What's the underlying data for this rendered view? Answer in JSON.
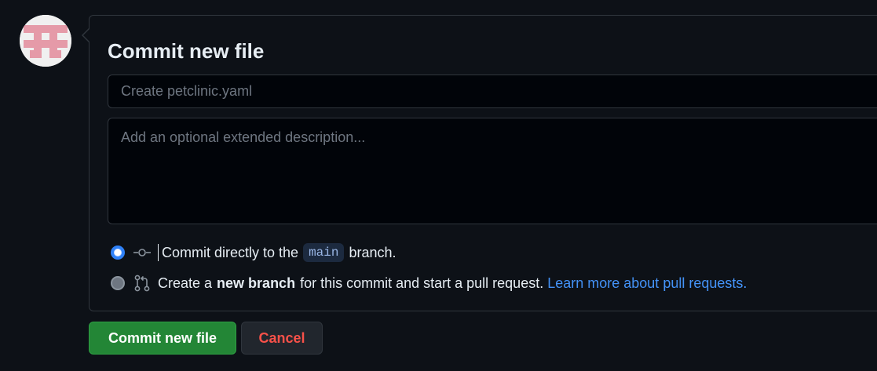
{
  "avatar": {
    "icon": "identicon-avatar",
    "color": "#e59aa8"
  },
  "commit": {
    "title": "Commit new file",
    "summary_placeholder": "Create petclinic.yaml",
    "summary_value": "",
    "description_placeholder": "Add an optional extended description...",
    "description_value": ""
  },
  "options": {
    "direct": {
      "selected": true,
      "icon": "git-commit-icon",
      "text_before": "Commit directly to the",
      "branch": "main",
      "text_after": "branch."
    },
    "new_branch": {
      "selected": false,
      "icon": "git-pull-request-icon",
      "text_before": "Create a",
      "bold_text": "new branch",
      "text_after": "for this commit and start a pull request.",
      "link_text": "Learn more about pull requests."
    }
  },
  "buttons": {
    "commit_label": "Commit new file",
    "cancel_label": "Cancel"
  },
  "colors": {
    "background": "#0d1117",
    "primary": "#238636",
    "danger": "#f85149",
    "accent": "#2f81f7",
    "link": "#4493f8"
  }
}
